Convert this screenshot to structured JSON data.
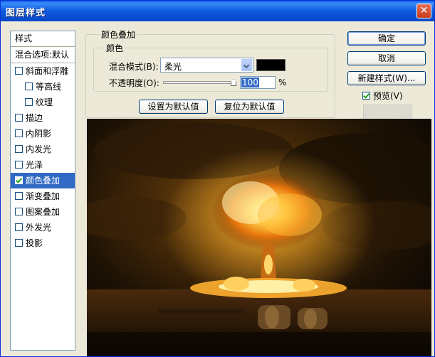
{
  "window": {
    "title": "图层样式",
    "close_symbol": "✕"
  },
  "styles_panel": {
    "header": "样式",
    "blend_options": "混合选项:默认",
    "items": [
      {
        "label": "斜面和浮雕",
        "checked": false,
        "sub": false,
        "selected": false
      },
      {
        "label": "等高线",
        "checked": false,
        "sub": true,
        "selected": false
      },
      {
        "label": "纹理",
        "checked": false,
        "sub": true,
        "selected": false
      },
      {
        "label": "描边",
        "checked": false,
        "sub": false,
        "selected": false
      },
      {
        "label": "内阴影",
        "checked": false,
        "sub": false,
        "selected": false
      },
      {
        "label": "内发光",
        "checked": false,
        "sub": false,
        "selected": false
      },
      {
        "label": "光泽",
        "checked": false,
        "sub": false,
        "selected": false
      },
      {
        "label": "颜色叠加",
        "checked": true,
        "sub": false,
        "selected": true
      },
      {
        "label": "渐变叠加",
        "checked": false,
        "sub": false,
        "selected": false
      },
      {
        "label": "图案叠加",
        "checked": false,
        "sub": false,
        "selected": false
      },
      {
        "label": "外发光",
        "checked": false,
        "sub": false,
        "selected": false
      },
      {
        "label": "投影",
        "checked": false,
        "sub": false,
        "selected": false
      }
    ]
  },
  "color_overlay": {
    "group_title": "颜色叠加",
    "subgroup_title": "颜色",
    "blend_mode_label": "混合模式(B):",
    "blend_mode_value": "柔光",
    "overlay_color": "#000000",
    "opacity_label": "不透明度(O):",
    "opacity_value": "100",
    "opacity_unit": "%",
    "opacity_percent": 100,
    "set_default_button": "设置为默认值",
    "reset_default_button": "复位为默认值"
  },
  "actions": {
    "ok": "确定",
    "cancel": "取消",
    "new_style": "新建样式(W)...",
    "preview_label": "预览(V)",
    "preview_checked": true
  },
  "colors": {
    "titlebar": "#0A5FE8",
    "dialog_bg": "#ECE9D8",
    "selection": "#316AC5"
  }
}
